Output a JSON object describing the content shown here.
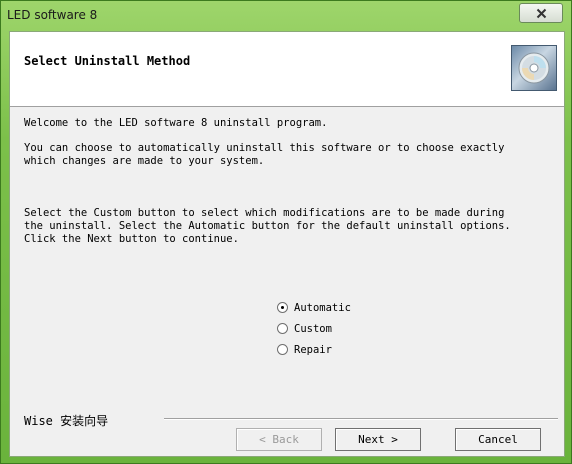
{
  "window": {
    "title": "LED software 8",
    "close_label": "x"
  },
  "header": {
    "title": "Select Uninstall Method",
    "icon": "cd-disc-icon"
  },
  "content": {
    "welcome": "Welcome to the LED software 8 uninstall program.",
    "paragraph1": "You can choose to automatically uninstall this software or to choose exactly\nwhich changes are made to your system.",
    "paragraph2": "Select the Custom button to select which modifications are to be made during\nthe uninstall. Select the Automatic button for the default uninstall options.\nClick the Next button to continue."
  },
  "options": [
    {
      "label": "Automatic",
      "selected": true
    },
    {
      "label": "Custom",
      "selected": false
    },
    {
      "label": "Repair",
      "selected": false
    }
  ],
  "footer": {
    "brand": "Wise 安装向导",
    "back_label": "< Back",
    "back_enabled": false,
    "next_label": "Next >",
    "cancel_label": "Cancel"
  }
}
